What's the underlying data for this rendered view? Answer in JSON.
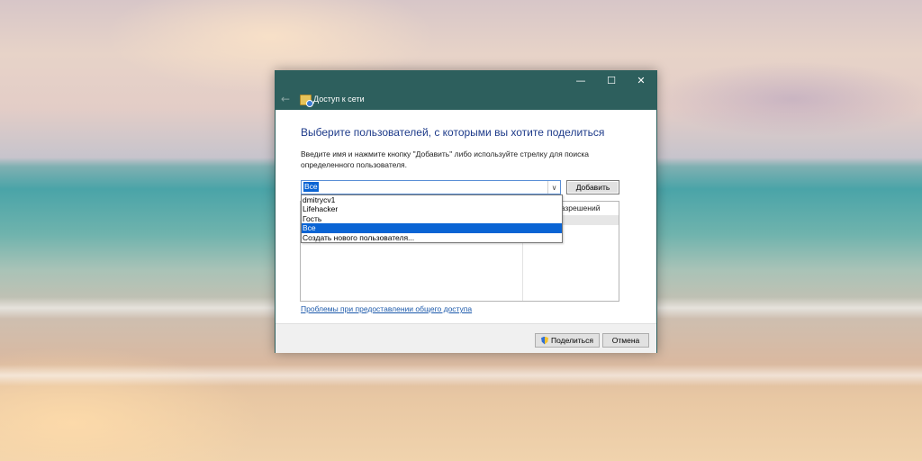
{
  "window": {
    "title": "Доступ к сети",
    "controls": {
      "minimize": "—",
      "maximize": "☐",
      "close": "✕"
    },
    "back": "←"
  },
  "content": {
    "heading": "Выберите пользователей, с которыми вы хотите поделиться",
    "instruction": "Введите имя и нажмите кнопку \"Добавить\" либо используйте стрелку для поиска определенного пользователя.",
    "combo_value": "Все",
    "combo_arrow": "∨",
    "add_button": "Добавить",
    "permissions_header": "разрешений",
    "dropdown_items": [
      "dmitrycv1",
      "Lifehacker",
      "Гость",
      "Все",
      "Создать нового пользователя..."
    ],
    "selected_index": 3,
    "troubleshoot_link": "Проблемы при предоставлении общего доступа"
  },
  "footer": {
    "share_button": "Поделиться",
    "cancel_button": "Отмена"
  },
  "colors": {
    "titlebar": "#2d5f5d",
    "selection": "#0a64d4",
    "heading": "#1e3b8a",
    "link": "#1d5aab"
  }
}
